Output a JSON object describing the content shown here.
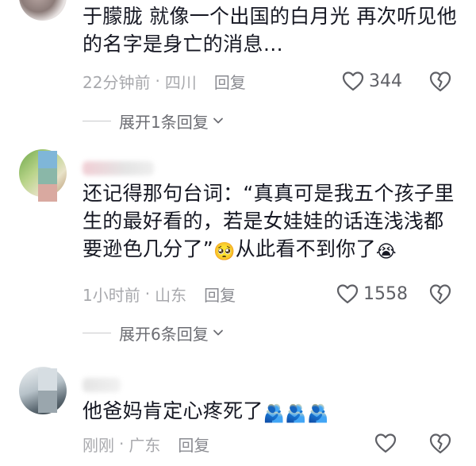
{
  "comments": [
    {
      "text": "于朦胧 就像一个出国的白月光  再次听见他的名字是身亡的消息…",
      "time": "22分钟前",
      "separator": "·",
      "location": "四川",
      "reply_label": "回复",
      "likes": "344",
      "expand_label": "展开1条回复"
    },
    {
      "text_before": "还记得那句台词：“真真可是我五个孩子里生的最好看的，若是女娃娃的话连浅浅都要逊色几分了”",
      "emoji_1": "🥺",
      "text_after": "从此看不到你了",
      "emoji_2": "😭",
      "time": "1小时前",
      "separator": "·",
      "location": "山东",
      "reply_label": "回复",
      "likes": "1558",
      "expand_label": "展开6条回复"
    },
    {
      "text": "他爸妈肯定心疼死了",
      "emojis": [
        "🫂",
        "🫂",
        "🫂"
      ],
      "time": "刚刚",
      "separator": "·",
      "location": "广东",
      "reply_label": "回复"
    }
  ],
  "icons": {
    "like": "heart-outline-icon",
    "dislike": "broken-heart-icon",
    "expand": "chevron-down-icon"
  },
  "colors": {
    "text": "#161823",
    "meta": "#a8a9ad",
    "icon": "#5f6066"
  }
}
